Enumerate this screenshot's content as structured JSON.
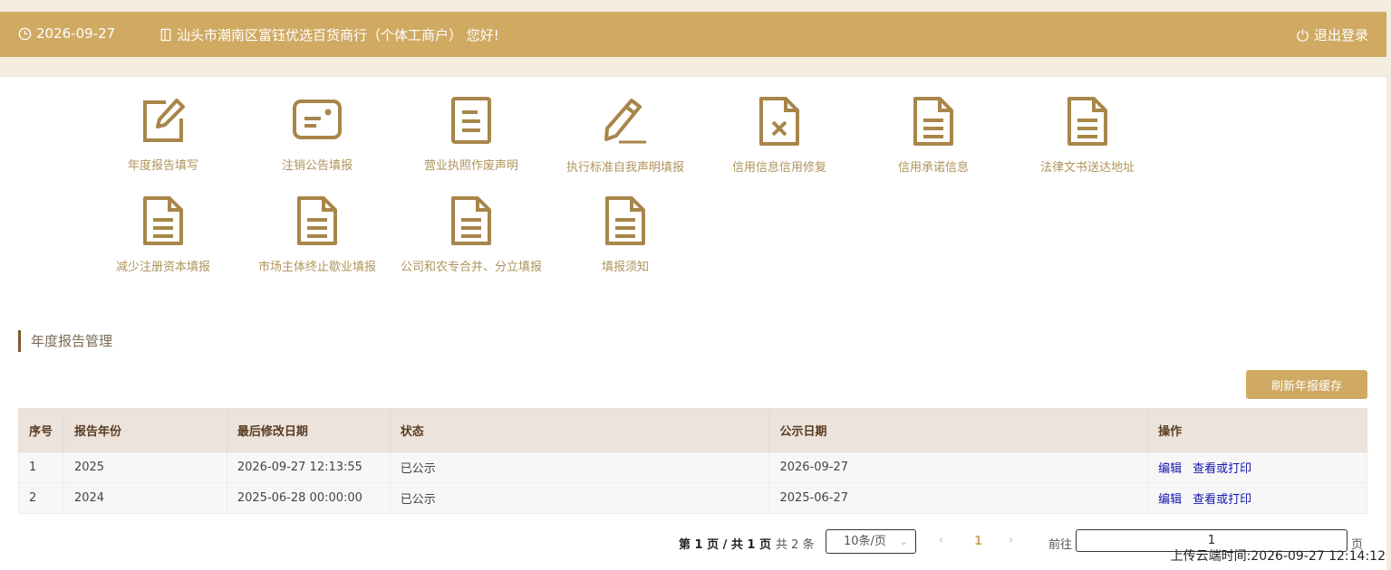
{
  "header": {
    "date": "2026-09-27",
    "greeting": "汕头市潮南区富钰优选百货商行（个体工商户） 您好!",
    "logout": "退出登录"
  },
  "menu": [
    {
      "label": "年度报告填写",
      "icon": "edit-icon"
    },
    {
      "label": "注销公告填报",
      "icon": "card-icon"
    },
    {
      "label": "营业执照作废声明",
      "icon": "document-icon"
    },
    {
      "label": "执行标准自我声明填报",
      "icon": "pencil-icon"
    },
    {
      "label": "信用信息信用修复",
      "icon": "document-x-icon"
    },
    {
      "label": "信用承诺信息",
      "icon": "document-folded-icon"
    },
    {
      "label": "法律文书送达地址",
      "icon": "document-folded-icon"
    },
    {
      "label": "减少注册资本填报",
      "icon": "document-folded-icon"
    },
    {
      "label": "市场主体终止歇业填报",
      "icon": "document-folded-icon"
    },
    {
      "label": "公司和农专合并、分立填报",
      "icon": "document-folded-icon"
    },
    {
      "label": "填报须知",
      "icon": "document-folded-icon"
    }
  ],
  "section": {
    "title": "年度报告管理"
  },
  "refresh_button": "刷新年报缓存",
  "table": {
    "columns": [
      "序号",
      "报告年份",
      "最后修改日期",
      "状态",
      "公示日期",
      "操作"
    ],
    "rows": [
      {
        "no": "1",
        "year": "2025",
        "modified": "2026-09-27 12:13:55",
        "status": "已公示",
        "public_date": "2026-09-27",
        "edit": "编辑",
        "view": "查看或打印"
      },
      {
        "no": "2",
        "year": "2024",
        "modified": "2025-06-28 00:00:00",
        "status": "已公示",
        "public_date": "2025-06-27",
        "edit": "编辑",
        "view": "查看或打印"
      }
    ]
  },
  "pagination": {
    "page_info": "第 1 页 / 共 1 页",
    "total": "共 2 条",
    "page_size": "10条/页",
    "current_page": "1",
    "goto_label": "前往",
    "goto_value": "1",
    "page_unit": "页"
  },
  "upload_time": "上传云端时间:2026-09-27 12:14:12",
  "colors": {
    "accent": "#d0aa63",
    "icon": "#a8864a",
    "link": "#1515b0"
  }
}
